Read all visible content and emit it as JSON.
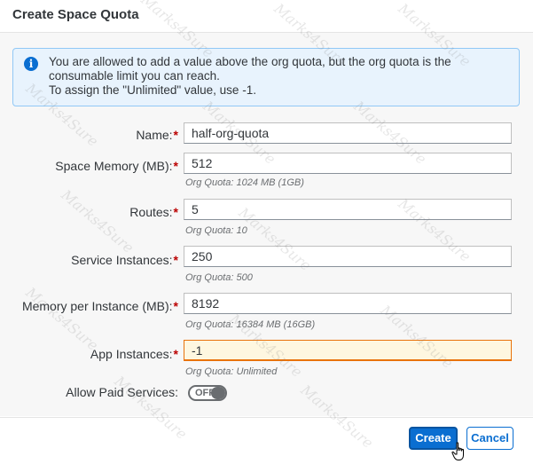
{
  "dialog": {
    "title": "Create Space Quota",
    "info": {
      "icon": "info-icon",
      "line1": "You are allowed to add a value above the org quota, but the org quota is the",
      "line2": "consumable limit you can reach.",
      "line3": "To assign the \"Unlimited\" value, use -1."
    },
    "fields": {
      "name": {
        "label": "Name:",
        "required": "*",
        "value": "half-org-quota"
      },
      "space_memory": {
        "label": "Space Memory (MB):",
        "required": "*",
        "value": "512",
        "hint": "Org Quota: 1024 MB (1GB)"
      },
      "routes": {
        "label": "Routes:",
        "required": "*",
        "value": "5",
        "hint": "Org Quota: 10"
      },
      "service_instances": {
        "label": "Service Instances:",
        "required": "*",
        "value": "250",
        "hint": "Org Quota: 500"
      },
      "memory_per_instance": {
        "label": "Memory per Instance (MB):",
        "required": "*",
        "value": "8192",
        "hint": "Org Quota: 16384 MB (16GB)"
      },
      "app_instances": {
        "label": "App Instances:",
        "required": "*",
        "value": "-1",
        "hint": "Org Quota: Unlimited"
      },
      "allow_paid_services": {
        "label": "Allow Paid Services:",
        "state": "OFF"
      }
    },
    "buttons": {
      "create": "Create",
      "cancel": "Cancel"
    },
    "watermark": "Marks4Sure"
  },
  "colors": {
    "accent": "#0a6ed1",
    "required": "#bb0000",
    "warning_bg": "#fef7e0",
    "warning_border": "#e9730c",
    "info_bg": "#e8f3fd"
  }
}
